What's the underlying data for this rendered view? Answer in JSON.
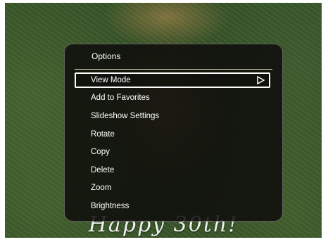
{
  "photo": {
    "caption": "Happy 30th!"
  },
  "menu": {
    "title": "Options",
    "items": [
      {
        "label": "View Mode",
        "selected": true,
        "has_submenu": true
      },
      {
        "label": "Add to Favorites"
      },
      {
        "label": "Slideshow Settings"
      },
      {
        "label": "Rotate"
      },
      {
        "label": "Copy"
      },
      {
        "label": "Delete"
      },
      {
        "label": "Zoom"
      },
      {
        "label": "Brightness"
      }
    ]
  },
  "icons": {
    "submenu": "triangle-right-outline-icon"
  }
}
